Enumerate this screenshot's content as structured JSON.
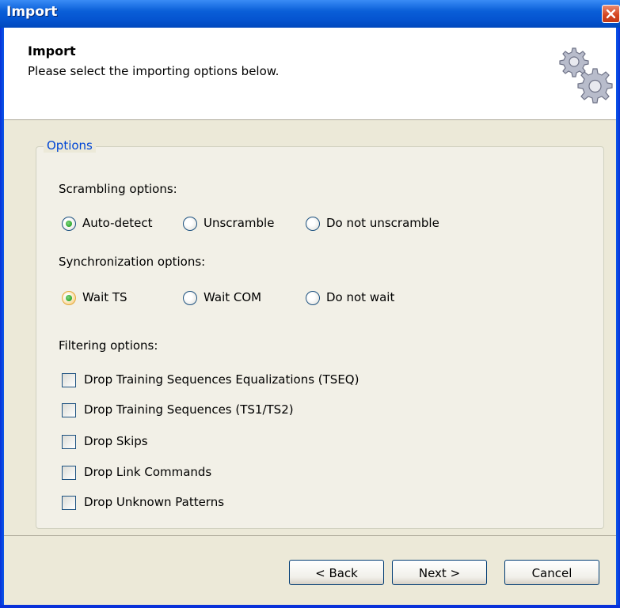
{
  "window": {
    "title": "Import"
  },
  "header": {
    "title": "Import",
    "subtitle": "Please select the importing options below."
  },
  "options": {
    "group_label": "Options",
    "scrambling": {
      "label": "Scrambling options:",
      "items": [
        "Auto-detect",
        "Unscramble",
        "Do not unscramble"
      ],
      "selected": "Auto-detect"
    },
    "synchronization": {
      "label": "Synchronization options:",
      "items": [
        "Wait TS",
        "Wait COM",
        "Do not wait"
      ],
      "selected": "Wait TS"
    },
    "filtering": {
      "label": "Filtering options:",
      "items": [
        "Drop Training Sequences Equalizations (TSEQ)",
        "Drop Training Sequences (TS1/TS2)",
        "Drop Skips",
        "Drop Link Commands",
        "Drop Unknown Patterns"
      ],
      "checked": [
        false,
        false,
        false,
        false,
        false
      ]
    }
  },
  "buttons": {
    "back": "< Back",
    "next": "Next >",
    "cancel": "Cancel"
  },
  "icons": {
    "close": "close-icon",
    "header": "gears-icon"
  },
  "colors": {
    "titlebar": "#0a5fd8",
    "group_label": "#0046d5",
    "dialog_bg": "#ece9d8"
  }
}
